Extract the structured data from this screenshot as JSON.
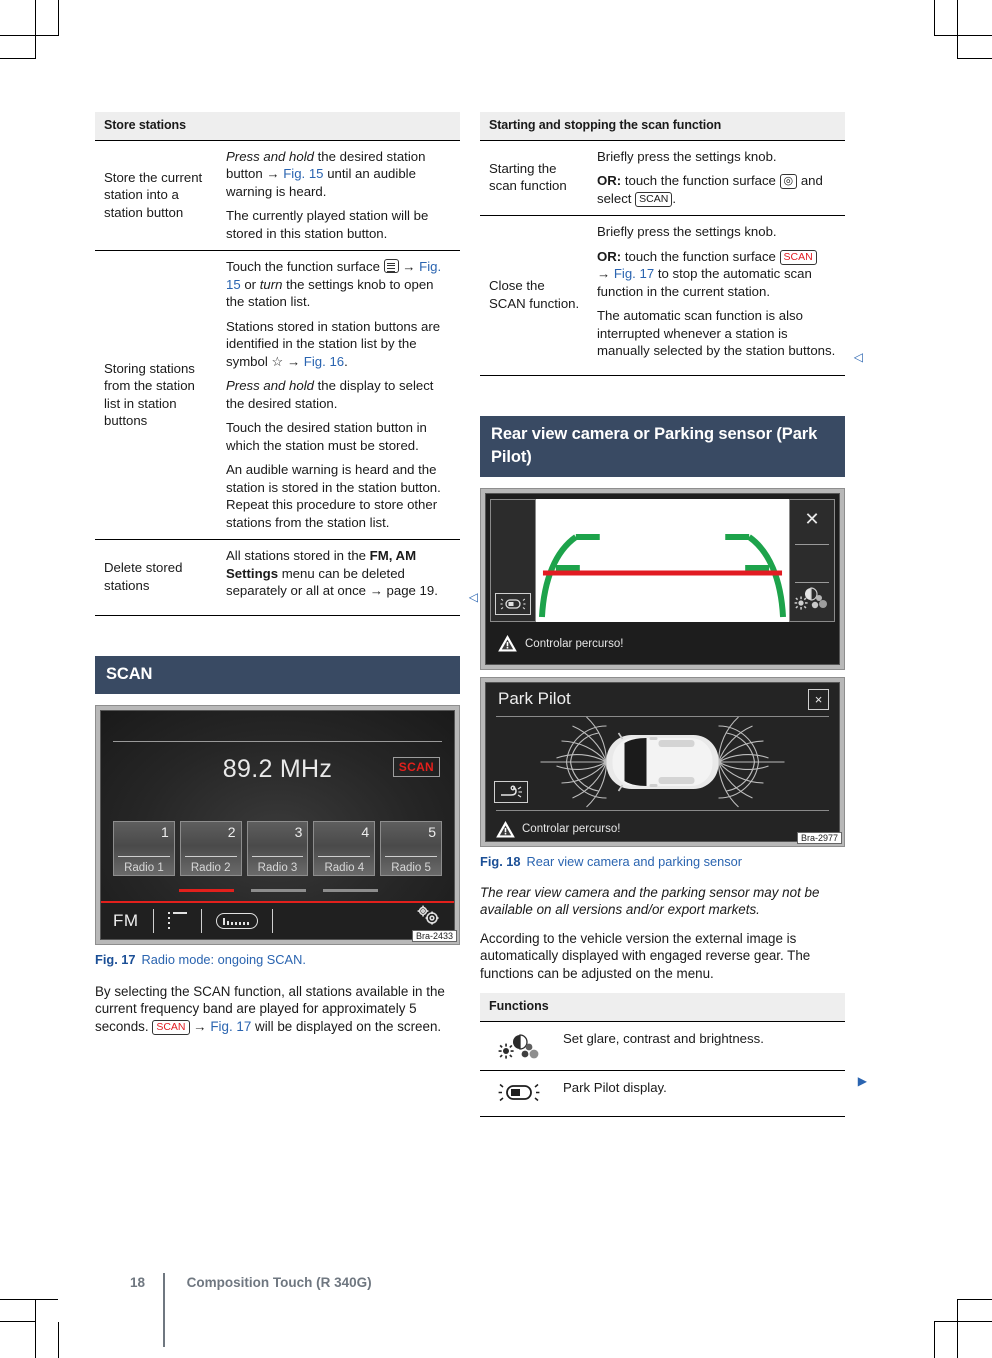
{
  "document": {
    "footer": {
      "page_number": "18",
      "title": "Composition Touch (R 340G)"
    }
  },
  "left_column": {
    "store_stations_table": {
      "header": "Store stations",
      "rows": [
        {
          "term": "Store the current station into a station button",
          "paragraphs": [
            {
              "parts": [
                {
                  "t": "Press and hold",
                  "s": "i"
                },
                {
                  "t": " the desired station button ",
                  "s": "n"
                },
                {
                  "t": "→ ",
                  "s": "n"
                },
                {
                  "t": "Fig. 15",
                  "s": "link"
                },
                {
                  "t": " until an audible warning is heard.",
                  "s": "n"
                }
              ]
            },
            {
              "parts": [
                {
                  "t": "The currently played station will be stored in this station button.",
                  "s": "n"
                }
              ]
            }
          ]
        },
        {
          "term": "Storing stations from the station list in station buttons",
          "paragraphs": [
            {
              "parts": [
                {
                  "t": "Touch the function surface ",
                  "s": "n"
                },
                {
                  "t": "list-icon",
                  "s": "glyph-list"
                },
                {
                  "t": " → ",
                  "s": "n"
                },
                {
                  "t": "Fig. 15",
                  "s": "link"
                },
                {
                  "t": " or ",
                  "s": "n"
                },
                {
                  "t": "turn",
                  "s": "i"
                },
                {
                  "t": " the settings knob to open the station list.",
                  "s": "n"
                }
              ]
            },
            {
              "parts": [
                {
                  "t": "Stations stored in station buttons are identified in the station list by the symbol ☆ → ",
                  "s": "n"
                },
                {
                  "t": "Fig. 16",
                  "s": "link"
                },
                {
                  "t": ".",
                  "s": "n"
                }
              ]
            },
            {
              "parts": [
                {
                  "t": "Press and hold",
                  "s": "i"
                },
                {
                  "t": " the display to select the desired station.",
                  "s": "n"
                }
              ]
            },
            {
              "parts": [
                {
                  "t": "Touch the desired station button in which the station must be stored.",
                  "s": "n"
                }
              ]
            },
            {
              "parts": [
                {
                  "t": "An audible warning is heard and the station is stored in the station button. Repeat this procedure to store other stations from the station list.",
                  "s": "n"
                }
              ]
            }
          ]
        },
        {
          "term": "Delete stored stations",
          "paragraphs": [
            {
              "parts": [
                {
                  "t": "All stations stored in the ",
                  "s": "n"
                },
                {
                  "t": "FM, AM Settings",
                  "s": "b"
                },
                {
                  "t": " menu can be deleted separately or all at once → page 19.",
                  "s": "n"
                }
              ]
            }
          ],
          "end_mark": "◁"
        }
      ]
    },
    "scan_section": {
      "heading": "SCAN",
      "figure": {
        "screen": {
          "frequency": "89.2 MHz",
          "scan_label": "SCAN",
          "presets": [
            {
              "number": "1",
              "name": "Radio 1"
            },
            {
              "number": "2",
              "name": "Radio 2"
            },
            {
              "number": "3",
              "name": "Radio 3"
            },
            {
              "number": "4",
              "name": "Radio 4"
            },
            {
              "number": "5",
              "name": "Radio 5"
            }
          ],
          "band_label": "FM",
          "toolbar_icons": [
            "station-list-icon",
            "equalizer-icon",
            "settings-gear-icon"
          ]
        },
        "code": "Bra-2433",
        "caption_label": "Fig. 17",
        "caption_text": "Radio mode: ongoing SCAN."
      },
      "body": [
        {
          "parts": [
            {
              "t": "By selecting the SCAN function, all stations available in the current frequency band are played for approximately 5 seconds. ",
              "s": "n"
            },
            {
              "t": "SCAN",
              "s": "key-red"
            },
            {
              "t": " → ",
              "s": "n"
            },
            {
              "t": "Fig. 17",
              "s": "link"
            },
            {
              "t": " will be displayed on the screen.",
              "s": "n"
            }
          ]
        }
      ]
    }
  },
  "right_column": {
    "scan_function_table": {
      "header": "Starting and stopping the scan function",
      "rows": [
        {
          "term": "Starting the scan function",
          "paragraphs": [
            {
              "parts": [
                {
                  "t": "Briefly press the settings knob.",
                  "s": "n"
                }
              ]
            },
            {
              "parts": [
                {
                  "t": "OR:",
                  "s": "b"
                },
                {
                  "t": " touch the function surface ",
                  "s": "n"
                },
                {
                  "t": "tuner-icon",
                  "s": "key-icon"
                },
                {
                  "t": " and select ",
                  "s": "n"
                },
                {
                  "t": "SCAN",
                  "s": "key"
                },
                {
                  "t": ".",
                  "s": "n"
                }
              ]
            }
          ]
        },
        {
          "term": "Close the SCAN function.",
          "paragraphs": [
            {
              "parts": [
                {
                  "t": "Briefly press the settings knob.",
                  "s": "n"
                }
              ]
            },
            {
              "parts": [
                {
                  "t": "OR:",
                  "s": "b"
                },
                {
                  "t": " touch the function surface ",
                  "s": "n"
                },
                {
                  "t": "SCAN",
                  "s": "key-red"
                },
                {
                  "t": " → ",
                  "s": "n"
                },
                {
                  "t": "Fig. 17",
                  "s": "link"
                },
                {
                  "t": " to stop the automatic scan function in the current station.",
                  "s": "n"
                }
              ]
            },
            {
              "parts": [
                {
                  "t": "The automatic scan function is also interrupted whenever a station is manually selected by the station buttons.",
                  "s": "n"
                }
              ]
            }
          ],
          "end_mark": "◁"
        }
      ]
    },
    "rear_view_section": {
      "heading": "Rear view camera or Parking sensor (Park Pilot)",
      "figure": {
        "camera_screen": {
          "warning_text": "Controlar percurso!",
          "left_button": "rear-camera-icon",
          "right_buttons": [
            "close-icon",
            "brightness-contrast-icon"
          ]
        },
        "park_pilot_screen": {
          "title": "Park Pilot",
          "close": "×",
          "warning_text": "Controlar percurso!",
          "tow_button": "trailer-icon"
        },
        "code": "Bra-2977",
        "caption_label": "Fig. 18",
        "caption_text": "Rear view camera and parking sensor"
      },
      "body": [
        {
          "italic": true,
          "parts": [
            {
              "t": "The rear view camera and the parking sensor may not be available on all versions and/or export markets.",
              "s": "n"
            }
          ]
        },
        {
          "italic": false,
          "parts": [
            {
              "t": "According to the vehicle version the external image is automatically displayed with engaged reverse gear. The functions can be adjusted on the menu.",
              "s": "n"
            }
          ]
        }
      ],
      "functions_table": {
        "header": "Functions",
        "rows": [
          {
            "icon": "brightness-contrast-icon",
            "text": "Set glare, contrast and brightness."
          },
          {
            "icon": "park-pilot-icon",
            "text": "Park Pilot display.",
            "end_mark": "▶"
          }
        ]
      }
    }
  },
  "colors": {
    "section_heading_bg": "#394a63",
    "table_header_bg": "#eeeeee",
    "link": "#2a64b0",
    "scan_red": "#e2201c",
    "guide_green": "#1da34b",
    "guide_red": "#e21b22",
    "footer_text": "#6f7780"
  }
}
